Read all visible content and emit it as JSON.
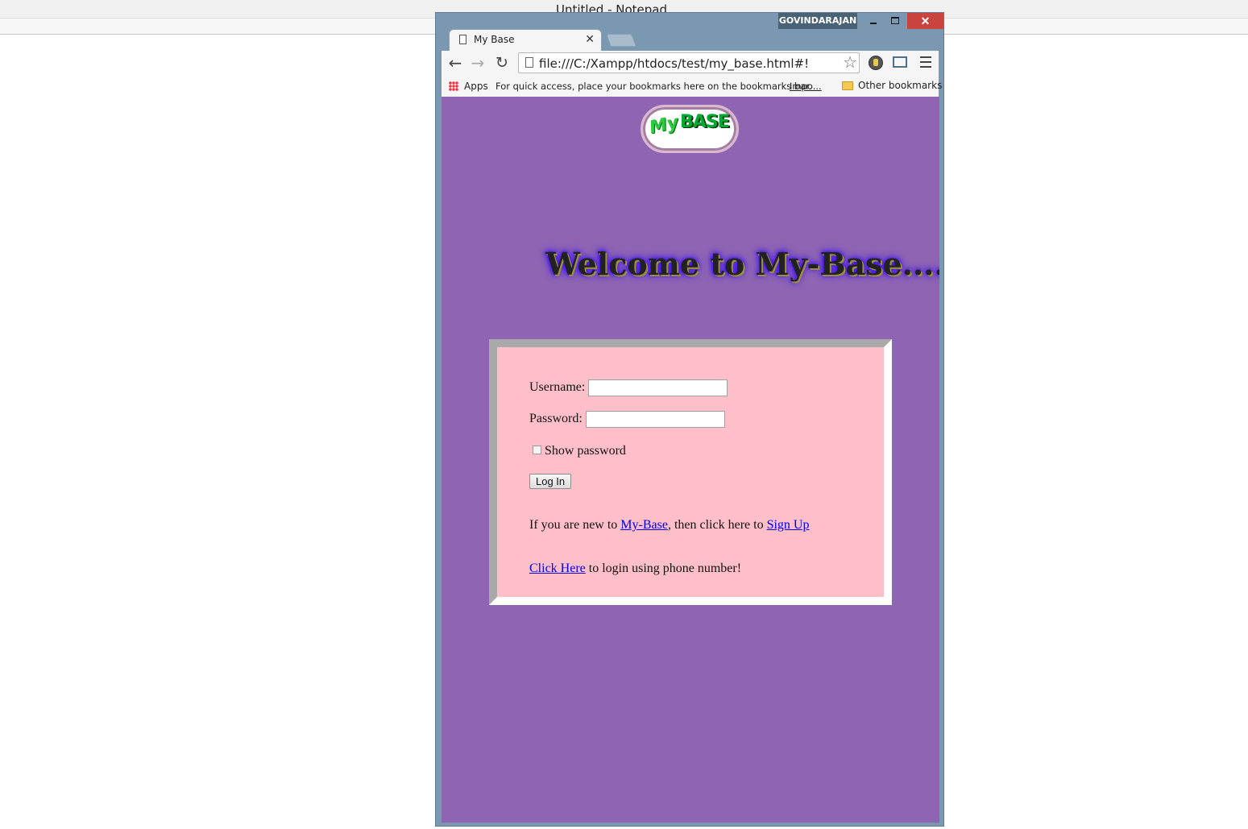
{
  "notepad": {
    "title": "Untitled - Notepad"
  },
  "chrome": {
    "user_badge": "GOVINDARAJAN",
    "close_glyph": "✕",
    "tab": {
      "title": "My Base",
      "close_glyph": "✕"
    },
    "nav": {
      "back": "←",
      "forward": "→",
      "reload": "↻"
    },
    "omnibox": {
      "url": "file:///C:/Xampp/htdocs/test/my_base.html#!",
      "star": "☆"
    },
    "bookmarks": {
      "apps_label": "Apps",
      "hint": "For quick access, place your bookmarks here on the bookmarks bar.",
      "import_link": "Impo...",
      "other_bookmarks": "Other bookmarks"
    }
  },
  "page": {
    "logo": {
      "my": "My",
      "base": "BASE"
    },
    "welcome": "Welcome to My-Base.........",
    "form": {
      "username_label": "Username:",
      "password_label": "Password:",
      "show_password_label": "Show password",
      "login_button": "Log In",
      "new_prefix": "If you are new to ",
      "new_link": "My-Base",
      "new_middle": ", then click here to ",
      "signup_link": "Sign Up",
      "phone_link": "Click Here",
      "phone_suffix": " to login using phone number!"
    }
  },
  "colors": {
    "page_bg": "#8e64b3",
    "form_bg": "#ffbfc8",
    "chrome_frame": "#7a98b1",
    "link": "#0000ee"
  }
}
